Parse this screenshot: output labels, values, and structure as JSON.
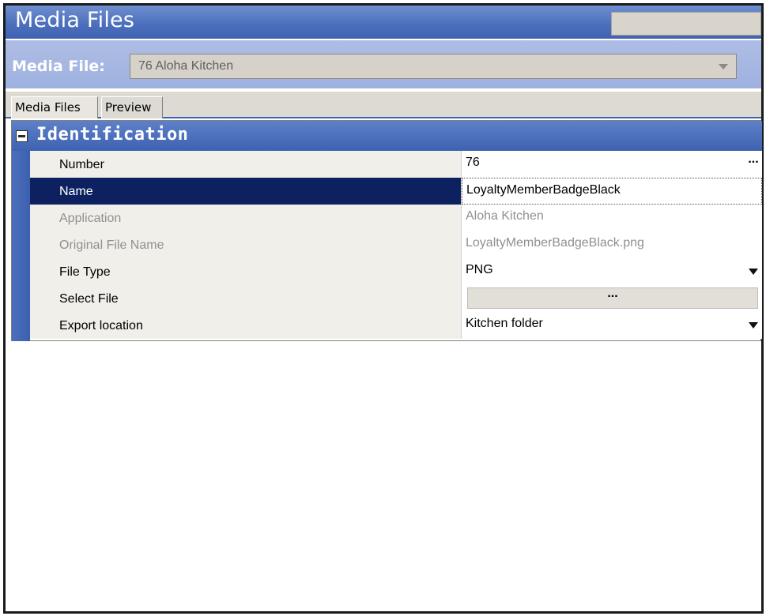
{
  "window": {
    "title": "Media Files"
  },
  "media_file": {
    "label": "Media File:",
    "selected": "76  Aloha Kitchen"
  },
  "tabs": [
    {
      "label": "Media Files",
      "active": true
    },
    {
      "label": "Preview",
      "active": false
    }
  ],
  "section": {
    "title": "Identification"
  },
  "properties": [
    {
      "name": "Number",
      "value": "76",
      "state": "normal",
      "control": "ellipsis"
    },
    {
      "name": "Name",
      "value": "LoyaltyMemberBadgeBlack",
      "state": "selected",
      "control": "text"
    },
    {
      "name": "Application",
      "value": "Aloha Kitchen",
      "state": "disabled",
      "control": "text"
    },
    {
      "name": "Original File Name",
      "value": "LoyaltyMemberBadgeBlack.png",
      "state": "disabled",
      "control": "text"
    },
    {
      "name": "File Type",
      "value": "PNG",
      "state": "normal",
      "control": "dropdown"
    },
    {
      "name": "Select File",
      "value": "...",
      "state": "normal",
      "control": "button"
    },
    {
      "name": "Export location",
      "value": "Kitchen folder",
      "state": "normal",
      "control": "dropdown"
    }
  ],
  "icons": {
    "ellipsis": "...",
    "collapse": "minus-box-icon",
    "dropdown": "chevron-down-icon"
  },
  "colors": {
    "title_bar": "#4d70bd",
    "selected_row": "#0d2161",
    "section_header": "#3e62b1"
  }
}
